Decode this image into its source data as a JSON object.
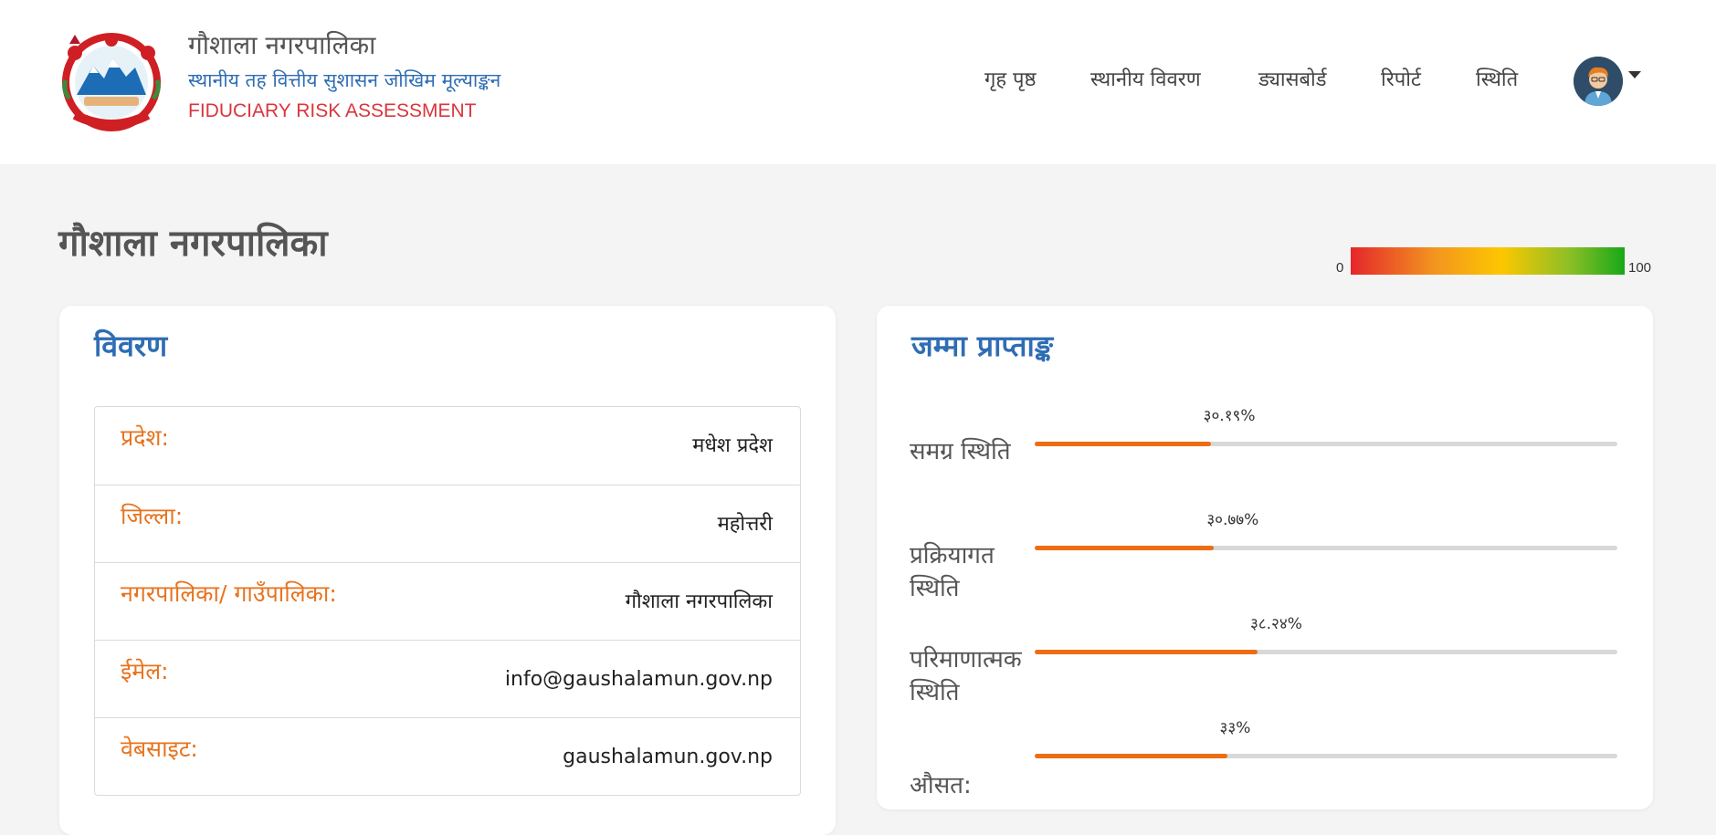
{
  "header": {
    "title": "गौशाला नगरपालिका",
    "subtitle": "स्थानीय तह वित्तीय सुशासन जोखिम मूल्याङ्कन",
    "english": "FIDUCIARY RISK ASSESSMENT"
  },
  "nav": {
    "items": [
      {
        "label": "गृह पृष्ठ"
      },
      {
        "label": "स्थानीय विवरण"
      },
      {
        "label": "ड्यासबोर्ड"
      },
      {
        "label": "रिपोर्ट"
      },
      {
        "label": "स्थिति"
      }
    ]
  },
  "page": {
    "title": "गौशाला नगरपालिका",
    "scale_min": "0",
    "scale_max": "100"
  },
  "details": {
    "title": "विवरण",
    "rows": [
      {
        "label": "प्रदेश:",
        "value": "मधेश प्रदेश"
      },
      {
        "label": "जिल्ला:",
        "value": "महोत्तरी"
      },
      {
        "label": "नगरपालिका/ गाउँपालिका:",
        "value": "गौशाला नगरपालिका"
      },
      {
        "label": "ईमेल:",
        "value": "info@gaushalamun.gov.np"
      },
      {
        "label": "वेबसाइट:",
        "value": "gaushalamun.gov.np"
      }
    ]
  },
  "scores": {
    "title": "जम्मा प्राप्ताङ्क",
    "items": [
      {
        "label": "समग्र स्थिति",
        "value": 30.19,
        "display": "३०.१९%"
      },
      {
        "label": "प्रक्रियागत स्थिति",
        "value": 30.77,
        "display": "३०.७७%"
      },
      {
        "label": "परिमाणात्मक स्थिति",
        "value": 38.24,
        "display": "३८.२४%"
      },
      {
        "label": "औसत:",
        "value": 33,
        "display": "३३%"
      }
    ]
  },
  "colors": {
    "accent_blue": "#2f6db3",
    "accent_orange": "#e8731e",
    "bar_fill": "#ec6d14",
    "brand_red": "#d9363e"
  }
}
